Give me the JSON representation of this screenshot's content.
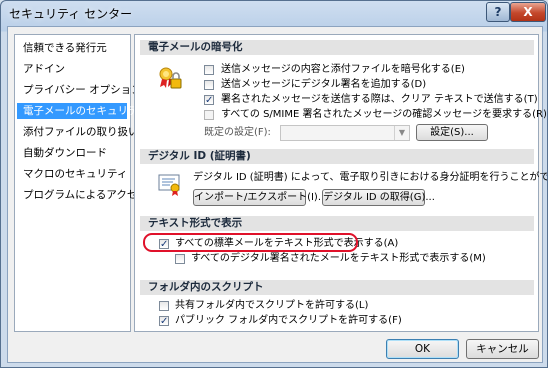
{
  "window": {
    "title": "セキュリティ センター",
    "help_label": "?",
    "close_label": "X"
  },
  "sidebar": {
    "items": [
      {
        "label": "信頼できる発行元",
        "active": false
      },
      {
        "label": "アドイン",
        "active": false
      },
      {
        "label": "プライバシー オプション",
        "active": false
      },
      {
        "label": "電子メールのセキュリティ",
        "active": true
      },
      {
        "label": "添付ファイルの取り扱い",
        "active": false
      },
      {
        "label": "自動ダウンロード",
        "active": false
      },
      {
        "label": "マクロのセキュリティ",
        "active": false
      },
      {
        "label": "プログラムによるアクセス",
        "active": false
      }
    ]
  },
  "encryption": {
    "header": "電子メールの暗号化",
    "icon": "lock-certificate-icon",
    "options": [
      {
        "label": "送信メッセージの内容と添付ファイルを暗号化する(E)",
        "checked": false
      },
      {
        "label": "送信メッセージにデジタル署名を追加する(D)",
        "checked": false
      },
      {
        "label": "署名されたメッセージを送信する際は、クリア テキストで送信する(T)",
        "checked": true
      },
      {
        "label": "すべての S/MIME 署名されたメッセージの確認メッセージを要求する(R)",
        "checked": false
      }
    ],
    "default_setting_label": "既定の設定(F):",
    "default_setting_value": "",
    "settings_button": "設定(S)..."
  },
  "digital_id": {
    "header": "デジタル ID (証明書)",
    "icon": "certificate-icon",
    "description": "デジタル ID (証明書) によって、電子取り引きにおける身分証明を行うことができます。",
    "import_export_button": "インポート/エクスポート(I)...",
    "get_id_button": "デジタル ID の取得(G)..."
  },
  "plain_text": {
    "header": "テキスト形式で表示",
    "options": [
      {
        "label": "すべての標準メールをテキスト形式で表示する(A)",
        "checked": true
      },
      {
        "label": "すべてのデジタル署名されたメールをテキスト形式で表示する(M)",
        "checked": false
      }
    ]
  },
  "folder_script": {
    "header": "フォルダ内のスクリプト",
    "options": [
      {
        "label": "共有フォルダ内でスクリプトを許可する(L)",
        "checked": false
      },
      {
        "label": "パブリック フォルダ内でスクリプトを許可する(F)",
        "checked": true
      }
    ]
  },
  "footer": {
    "ok_label": "OK",
    "cancel_label": "キャンセル"
  },
  "colors": {
    "selection": "#3399ff",
    "highlight_ring": "#e0112a"
  }
}
